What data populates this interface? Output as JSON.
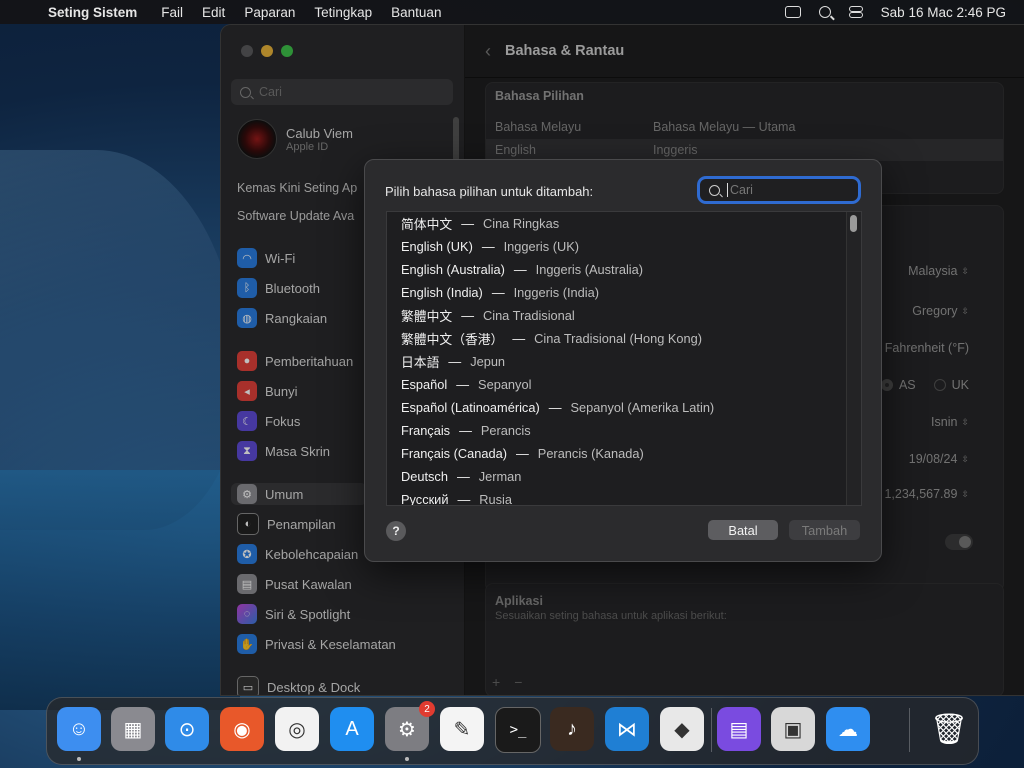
{
  "menubar": {
    "app": "Seting Sistem",
    "items": [
      "Fail",
      "Edit",
      "Paparan",
      "Tetingkap",
      "Bantuan"
    ],
    "clock": "Sab 16 Mac  2:46 PG"
  },
  "sidebar": {
    "search_placeholder": "Cari",
    "profile_name": "Calub Viem",
    "profile_sub": "Apple ID",
    "update_1": "Kemas Kini Seting Ap",
    "update_2": "Software Update Ava",
    "items": [
      {
        "label": "Wi-Fi",
        "color": "#2a7de1"
      },
      {
        "label": "Bluetooth",
        "color": "#2a7de1"
      },
      {
        "label": "Rangkaian",
        "color": "#2a7de1"
      },
      {
        "label": "Pemberitahuan",
        "color": "#e0413a"
      },
      {
        "label": "Bunyi",
        "color": "#e0413a"
      },
      {
        "label": "Fokus",
        "color": "#5e4bd6"
      },
      {
        "label": "Masa Skrin",
        "color": "#5e4bd6"
      },
      {
        "label": "Umum",
        "color": "#8e8e93"
      },
      {
        "label": "Penampilan",
        "color": "#222222"
      },
      {
        "label": "Kebolehcapaian",
        "color": "#2a7de1"
      },
      {
        "label": "Pusat Kawalan",
        "color": "#8e8e93"
      },
      {
        "label": "Siri & Spotlight",
        "color": "#c046d6"
      },
      {
        "label": "Privasi & Keselamatan",
        "color": "#2a7de1"
      },
      {
        "label": "Desktop & Dock",
        "color": "#333333"
      }
    ]
  },
  "content": {
    "title": "Bahasa & Rantau",
    "preferred_header": "Bahasa Pilihan",
    "lang_rows": [
      {
        "name": "Bahasa Melayu",
        "desc": "Bahasa Melayu — Utama"
      },
      {
        "name": "English",
        "desc": "Inggeris"
      }
    ],
    "region": "Malaysia",
    "calendar": "Gregory",
    "temp_f": "Fahrenheit (°F)",
    "measure_k": "k",
    "measure_as": "AS",
    "measure_uk": "UK",
    "first_day": "Isnin",
    "date_format": "19/08/24",
    "number_format": "1,234,567.89",
    "apps_title": "Aplikasi",
    "apps_desc": "Sesuaikan seting bahasa untuk aplikasi berikut:",
    "plus": "+",
    "minus": "−"
  },
  "sheet": {
    "prompt": "Pilih bahasa pilihan untuk ditambah:",
    "search_placeholder": "Cari",
    "separator": "—",
    "languages": [
      {
        "native": "简体中文",
        "trans": "Cina Ringkas"
      },
      {
        "native": "English (UK)",
        "trans": "Inggeris (UK)"
      },
      {
        "native": "English (Australia)",
        "trans": "Inggeris (Australia)"
      },
      {
        "native": "English (India)",
        "trans": "Inggeris (India)"
      },
      {
        "native": "繁體中文",
        "trans": "Cina Tradisional"
      },
      {
        "native": "繁體中文（香港）",
        "trans": "Cina Tradisional (Hong Kong)"
      },
      {
        "native": "日本語",
        "trans": "Jepun"
      },
      {
        "native": "Español",
        "trans": "Sepanyol"
      },
      {
        "native": "Español (Latinoamérica)",
        "trans": "Sepanyol (Amerika Latin)"
      },
      {
        "native": "Français",
        "trans": "Perancis"
      },
      {
        "native": "Français (Canada)",
        "trans": "Perancis (Kanada)"
      },
      {
        "native": "Deutsch",
        "trans": "Jerman"
      },
      {
        "native": "Русский",
        "trans": "Rusia"
      }
    ],
    "help_label": "?",
    "cancel_label": "Batal",
    "add_label": "Tambah"
  },
  "dock": {
    "items": [
      {
        "name": "finder-icon",
        "bg": "#3d8ef0",
        "glyph": "☺",
        "dot": true
      },
      {
        "name": "launchpad-icon",
        "bg": "#8a8a90",
        "glyph": "▦",
        "dot": false
      },
      {
        "name": "safari-icon",
        "bg": "#2f8be8",
        "glyph": "⊙",
        "dot": false
      },
      {
        "name": "firefox-icon",
        "bg": "#e8582a",
        "glyph": "◉",
        "dot": false
      },
      {
        "name": "chrome-icon",
        "bg": "#f2f2f2",
        "glyph": "◎",
        "dot": false
      },
      {
        "name": "app-store-icon",
        "bg": "#1f8ef0",
        "glyph": "A",
        "dot": false
      },
      {
        "name": "system-settings-icon",
        "bg": "#7d7d82",
        "glyph": "⚙",
        "dot": true,
        "badge": "2"
      },
      {
        "name": "textedit-icon",
        "bg": "#f4f4f4",
        "glyph": "✎",
        "dot": false
      },
      {
        "name": "terminal-icon",
        "bg": "#1a1a1a",
        "glyph": ">_",
        "dot": false
      },
      {
        "name": "garageband-icon",
        "bg": "#3a2a20",
        "glyph": "♪",
        "dot": false
      },
      {
        "name": "vscode-icon",
        "bg": "#1f7fd4",
        "glyph": "⋈",
        "dot": false
      },
      {
        "name": "roblox-icon",
        "bg": "#e8e8e8",
        "glyph": "◆",
        "dot": false
      },
      {
        "name": "storage-icon",
        "bg": "#7a4be0",
        "glyph": "▤",
        "dot": false
      },
      {
        "name": "boot-camp-icon",
        "bg": "#d8d8d8",
        "glyph": "▣",
        "dot": false
      },
      {
        "name": "weather-icon",
        "bg": "#2f8ef0",
        "glyph": "☁",
        "dot": false
      },
      {
        "name": "trash-icon",
        "bg": "transparent",
        "glyph": "🗑",
        "dot": false
      }
    ]
  }
}
